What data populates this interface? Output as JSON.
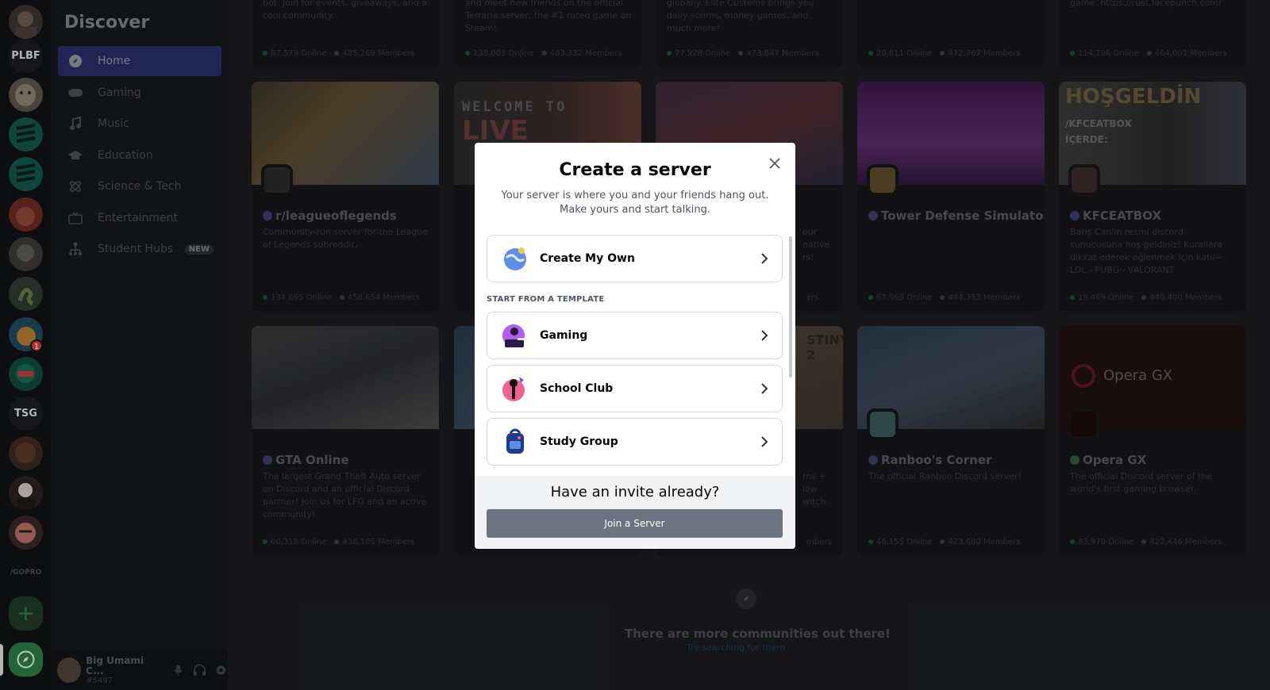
{
  "sidebar": {
    "title": "Discover",
    "items": [
      {
        "label": "Home",
        "icon": "compass-icon"
      },
      {
        "label": "Gaming",
        "icon": "controller-icon"
      },
      {
        "label": "Music",
        "icon": "music-note-icon"
      },
      {
        "label": "Education",
        "icon": "graduation-cap-icon"
      },
      {
        "label": "Science & Tech",
        "icon": "atom-icon"
      },
      {
        "label": "Entertainment",
        "icon": "tv-icon"
      },
      {
        "label": "Student Hubs",
        "icon": "hub-icon",
        "tag": "NEW"
      }
    ]
  },
  "rail": {
    "texts": {
      "plbf": "PLBF",
      "tsg": "TSG",
      "gopro": "/GOPRO"
    },
    "badge": "1"
  },
  "user": {
    "name": "Big Umami C...",
    "tag": "#5497"
  },
  "cards_top": [
    {
      "desc": "bot. Join for events, giveaways, and a cool community.",
      "online": "87,579 Online",
      "members": "485,269 Members"
    },
    {
      "desc": "and meet new friends on the official Terraria server, the #1 rated game on Steam!",
      "online": "138,003 Online",
      "members": "483,332 Members"
    },
    {
      "desc": "globally. Elite Customs brings you daily scrims, money games, and much more!",
      "online": "77,928 Online",
      "members": "473,847 Members"
    },
    {
      "desc": "",
      "online": "20,811 Online",
      "members": "472,762 Members"
    },
    {
      "desc": "game. https://rust.facepunch.com/",
      "online": "114,786 Online",
      "members": "464,001 Members"
    }
  ],
  "cards_mid": [
    {
      "name": "r/leagueoflegends",
      "desc": "Community-run server for the League of Legends subreddit.",
      "online": "134,695 Online",
      "members": "458,654 Members"
    },
    {
      "name": "",
      "desc": "",
      "online": "",
      "members": ""
    },
    {
      "name": "",
      "desc": "our native rs!",
      "online": "",
      "members": "ers"
    },
    {
      "name": "Tower Defense Simulator",
      "desc": "",
      "online": "67,969 Online",
      "members": "444,353 Members"
    },
    {
      "name": "KFCEATBOX",
      "desc": "Barış Can'ın resmi discord sunucusuna hoş geldiniz! Kurallara dikkat ederek eğlenmek için katıl~ LOL - PUBG - VALORANT",
      "online": "19,469 Online",
      "members": "440,400 Members"
    }
  ],
  "cards_bot": [
    {
      "name": "GTA Online",
      "desc": "The largest Grand Theft Auto server on Discord and an official Discord partner! Join us for LFG and an active community!",
      "online": "60,318 Online",
      "members": "436,105 Members"
    },
    {
      "name": "",
      "desc": "",
      "online": "",
      "members": ""
    },
    {
      "name": "",
      "desc": "rns + low witch.",
      "online": "",
      "members": "mbers"
    },
    {
      "name": "Ranboo's Corner",
      "desc": "The official Ranboo Discord server!",
      "online": "46,155 Online",
      "members": "423,680 Members"
    },
    {
      "name": "Opera GX",
      "desc": "The official Discord server of the world's first gaming browser.",
      "online": "83,970 Online",
      "members": "422,446 Members"
    }
  ],
  "banner_texts": {
    "welcome": "WELCOME TO",
    "live": "LIVE",
    "hosgeldin": "HOŞGELDİN",
    "kfc": "/KFCEATBOX",
    "icerde": "İÇERDE:",
    "operagx": "Opera GX",
    "destiny": "STINY 2"
  },
  "footer": {
    "title": "There are more communities out there!",
    "link": "Try searching for them"
  },
  "modal": {
    "title": "Create a server",
    "subtitle": "Your server is where you and your friends hang out. Make yours and start talking.",
    "create_own": "Create My Own",
    "template_header": "START FROM A TEMPLATE",
    "templates": [
      {
        "label": "Gaming"
      },
      {
        "label": "School Club"
      },
      {
        "label": "Study Group"
      }
    ],
    "invite_title": "Have an invite already?",
    "join_button": "Join a Server"
  },
  "colors": {
    "blurple": "#5865f2",
    "overlay": "rgba(0,0,0,0.85)",
    "join": "#6a7480"
  }
}
